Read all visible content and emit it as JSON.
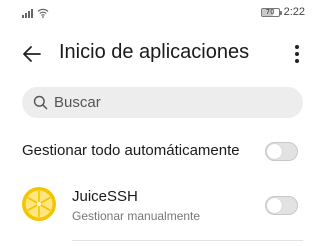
{
  "status_bar": {
    "battery_level": "70",
    "time": "2:22",
    "icons": [
      "signal-icon",
      "wifi-icon",
      "battery-icon"
    ]
  },
  "toolbar": {
    "title": "Inicio de aplicaciones",
    "icons": [
      "back-arrow-icon",
      "more-options-icon"
    ]
  },
  "search": {
    "placeholder": "Buscar",
    "value": ""
  },
  "auto_manage": {
    "label": "Gestionar todo automáticamente",
    "enabled": false
  },
  "apps": [
    {
      "name": "JuiceSSH",
      "status": "Gestionar manualmente",
      "icon": "juicessh-lemon-icon",
      "enabled": false
    }
  ],
  "colors": {
    "background": "#ffffff",
    "search_bg": "#ededed",
    "toggle_off": "#e2e2e2",
    "lemon_yellow": "#f5c400"
  }
}
